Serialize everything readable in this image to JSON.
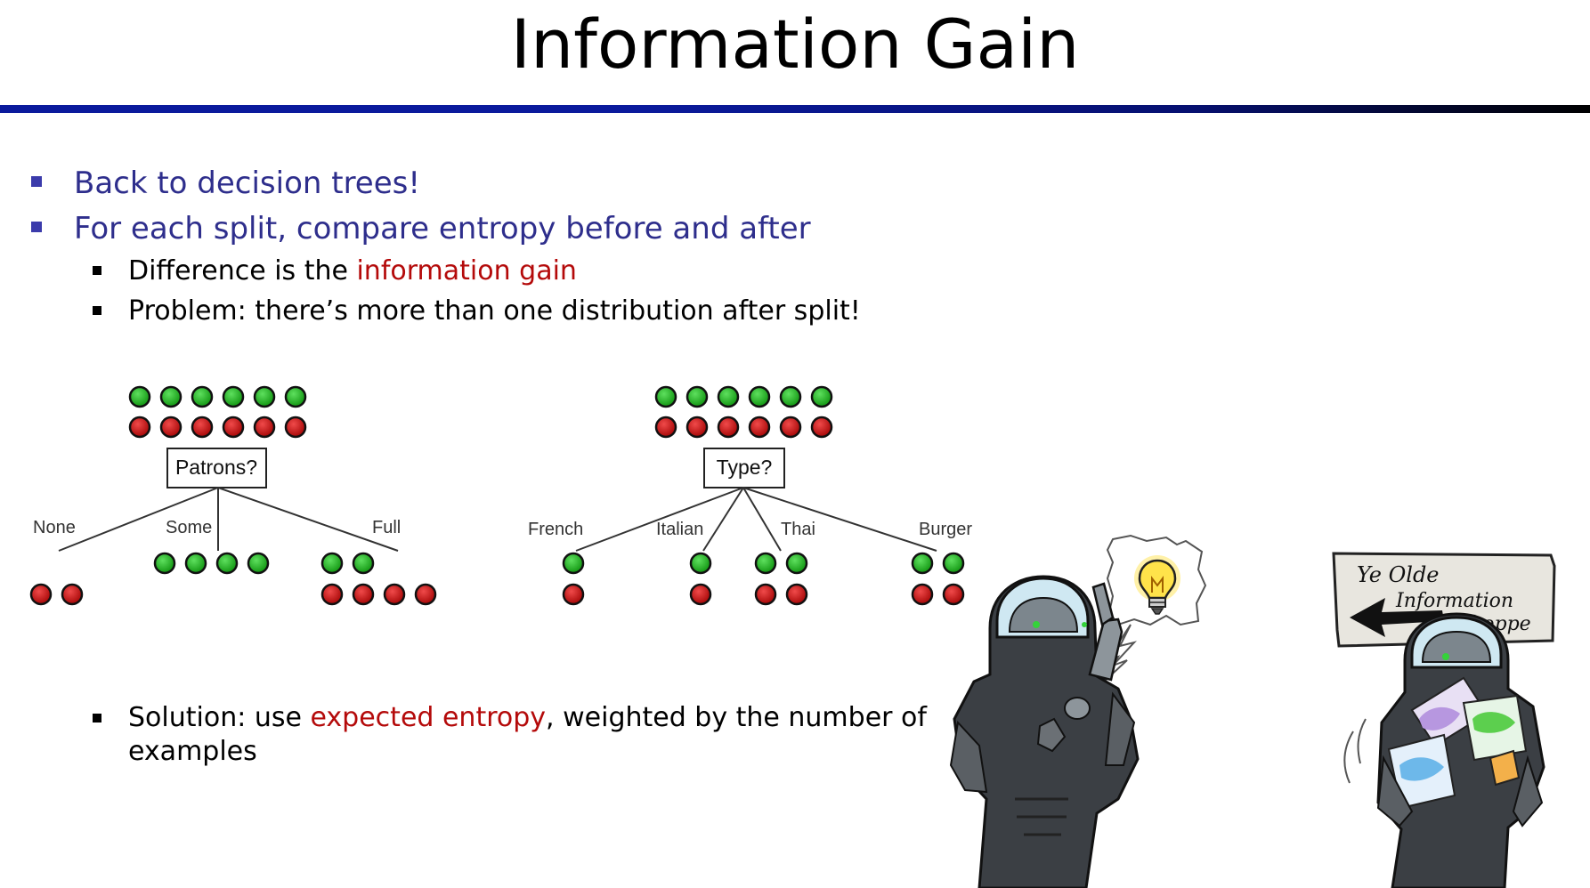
{
  "slide": {
    "title": "Information Gain",
    "bullets": [
      {
        "text": "Back to decision trees!"
      },
      {
        "text": "For each split, compare entropy before and after"
      }
    ],
    "sub_bullets": [
      {
        "prefix": "Difference is the ",
        "highlight": "information gain",
        "suffix": ""
      },
      {
        "prefix": "Problem: there’s more than one distribution after split!",
        "highlight": "",
        "suffix": ""
      }
    ],
    "solution": {
      "prefix": "Solution: use ",
      "highlight": "expected entropy",
      "suffix": ", weighted by the number of",
      "line2": "examples"
    }
  },
  "trees": [
    {
      "question": "Patrons?",
      "root": {
        "green": 6,
        "red": 6
      },
      "branches": [
        {
          "label": "None",
          "green": 0,
          "red": 2
        },
        {
          "label": "Some",
          "green": 4,
          "red": 0
        },
        {
          "label": "Full",
          "green": 2,
          "red": 4
        }
      ]
    },
    {
      "question": "Type?",
      "root": {
        "green": 6,
        "red": 6
      },
      "branches": [
        {
          "label": "French",
          "green": 1,
          "red": 1
        },
        {
          "label": "Italian",
          "green": 1,
          "red": 1
        },
        {
          "label": "Thai",
          "green": 2,
          "red": 2
        },
        {
          "label": "Burger",
          "green": 2,
          "red": 2
        }
      ]
    }
  ],
  "sign": {
    "line1": "Ye Olde",
    "line2": "Information",
    "line3": "Shoppe"
  },
  "colors": {
    "title_bar": "#0a1a9c",
    "bullet_text": "#2e2e8c",
    "highlight": "#b40a0a",
    "green_dot": "#1fa81f",
    "red_dot": "#c40d0d",
    "robot_body": "#3b3f44"
  },
  "icons": [
    "lightbulb-icon",
    "arrow-left-icon"
  ]
}
